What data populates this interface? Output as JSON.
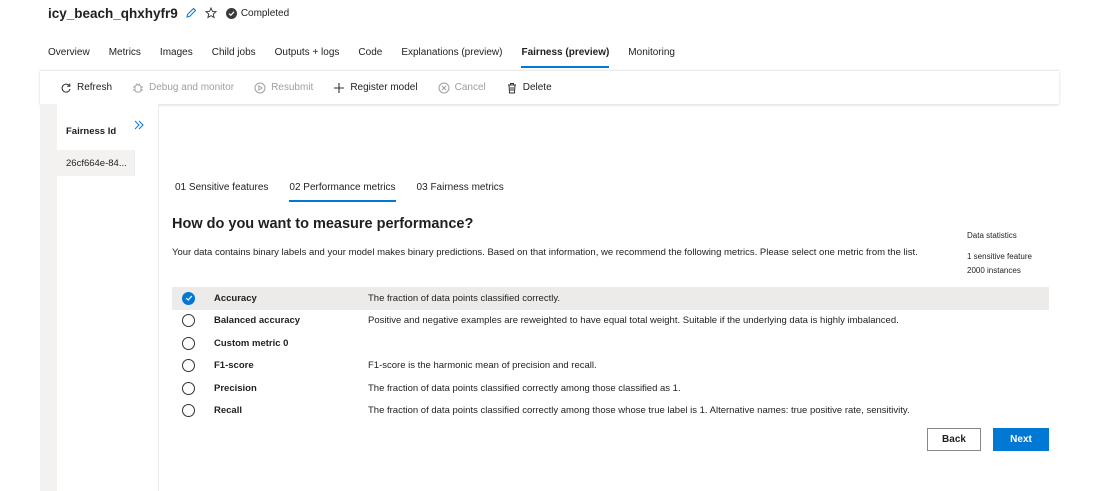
{
  "header": {
    "run_name": "icy_beach_qhxhyfr9",
    "status": "Completed"
  },
  "tabs": [
    {
      "label": "Overview"
    },
    {
      "label": "Metrics"
    },
    {
      "label": "Images"
    },
    {
      "label": "Child jobs"
    },
    {
      "label": "Outputs + logs"
    },
    {
      "label": "Code"
    },
    {
      "label": "Explanations (preview)"
    },
    {
      "label": "Fairness (preview)",
      "active": true
    },
    {
      "label": "Monitoring"
    }
  ],
  "toolbar": {
    "refresh": "Refresh",
    "debug": "Debug and monitor",
    "resubmit": "Resubmit",
    "register": "Register model",
    "cancel": "Cancel",
    "delete": "Delete"
  },
  "fairness_panel": {
    "header": "Fairness Id",
    "value": "26cf664e-84..."
  },
  "wizard_tabs": [
    {
      "label": "01 Sensitive features"
    },
    {
      "label": "02 Performance metrics",
      "active": true
    },
    {
      "label": "03 Fairness metrics"
    }
  ],
  "main": {
    "question": "How do you want to measure performance?",
    "description": "Your data contains binary labels and your model makes binary predictions. Based on that information, we recommend the following metrics. Please select one metric from the list."
  },
  "stats": {
    "title": "Data statistics",
    "line1": "1 sensitive feature",
    "line2": "2000 instances"
  },
  "metrics": [
    {
      "name": "Accuracy",
      "desc": "The fraction of data points classified correctly.",
      "selected": true
    },
    {
      "name": "Balanced accuracy",
      "desc": "Positive and negative examples are reweighted to have equal total weight. Suitable if the underlying data is highly imbalanced."
    },
    {
      "name": "Custom metric 0",
      "desc": ""
    },
    {
      "name": "F1-score",
      "desc": "F1-score is the harmonic mean of precision and recall."
    },
    {
      "name": "Precision",
      "desc": "The fraction of data points classified correctly among those classified as 1."
    },
    {
      "name": "Recall",
      "desc": "The fraction of data points classified correctly among those whose true label is 1. Alternative names: true positive rate, sensitivity."
    }
  ],
  "buttons": {
    "back": "Back",
    "next": "Next"
  },
  "colors": {
    "accent": "#0078d4",
    "selected_row": "#edebe9"
  }
}
